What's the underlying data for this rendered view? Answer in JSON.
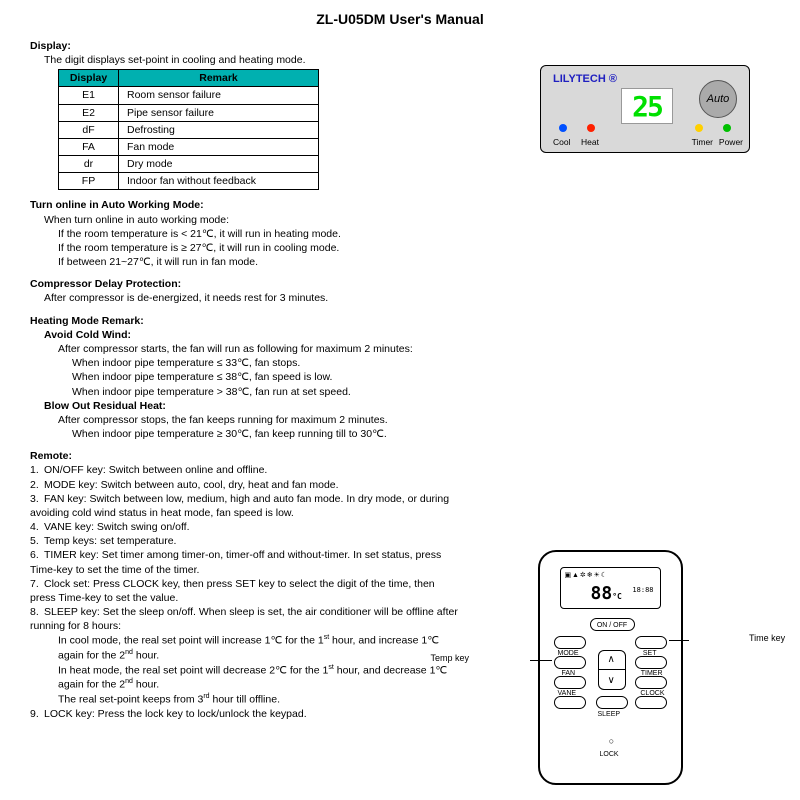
{
  "title": "ZL-U05DM User's Manual",
  "display": {
    "heading": "Display:",
    "intro": "The digit displays set-point in cooling and heating mode.",
    "headers": {
      "c1": "Display",
      "c2": "Remark"
    },
    "rows": [
      {
        "code": "E1",
        "remark": "Room sensor failure"
      },
      {
        "code": "E2",
        "remark": "Pipe sensor failure"
      },
      {
        "code": "dF",
        "remark": "Defrosting"
      },
      {
        "code": "FA",
        "remark": "Fan mode"
      },
      {
        "code": "dr",
        "remark": "Dry mode"
      },
      {
        "code": "FP",
        "remark": "Indoor fan without feedback"
      }
    ]
  },
  "panel": {
    "brand": "LILYTECH ®",
    "auto": "Auto",
    "digits": "25",
    "labels": {
      "cool": "Cool",
      "heat": "Heat",
      "timer": "Timer",
      "power": "Power"
    }
  },
  "auto_mode": {
    "heading": "Turn online in Auto Working Mode:",
    "l1": "When turn online in auto working mode:",
    "l2": "If the room temperature is < 21℃, it will run in heating mode.",
    "l3": "If the room temperature is ≥ 27℃, it will run in cooling mode.",
    "l4": "If between 21~27℃, it will run in fan mode."
  },
  "compressor": {
    "heading": "Compressor Delay Protection:",
    "l1": "After compressor is de-energized, it needs rest for 3 minutes."
  },
  "heating": {
    "heading": "Heating Mode Remark:",
    "avoid_h": "Avoid Cold Wind:",
    "a1": "After compressor starts, the fan will run as following for maximum 2 minutes:",
    "a2": "When indoor pipe temperature ≤ 33℃, fan stops.",
    "a3": "When indoor pipe temperature ≤ 38℃, fan speed is low.",
    "a4": "When indoor pipe temperature > 38℃, fan run at set speed.",
    "blow_h": "Blow Out Residual Heat:",
    "b1": "After compressor stops, the fan keeps running for maximum 2 minutes.",
    "b2": "When indoor pipe temperature ≥ 30℃, fan keep running till to 30℃."
  },
  "remote": {
    "heading": "Remote:",
    "callout_temp": "Temp key",
    "callout_time": "Time key",
    "onoff": "ON / OFF",
    "mode": "MODE",
    "set": "SET",
    "fan": "FAN",
    "timer": "TIMER",
    "vane": "VANE",
    "sleep": "SLEEP",
    "clock": "CLOCK",
    "lock": "LOCK",
    "lcd_temp": "88",
    "lcd_unit": "°C",
    "lcd_time": "18:88",
    "items": [
      "ON/OFF key: Switch between online and offline.",
      "MODE key: Switch between auto, cool, dry, heat and fan mode.",
      "FAN key: Switch between low, medium, high and auto fan mode. In dry mode, or during avoiding cold wind status in heat mode, fan speed is low.",
      "VANE key: Switch swing on/off.",
      "Temp keys: set temperature.",
      "TIMER key: Set timer among timer-on, timer-off and without-timer. In set status, press Time-key to set the time of the timer.",
      "Clock set: Press CLOCK key, then press SET key to select the digit of the time, then press Time-key to set the value.",
      "SLEEP key: Set the sleep on/off. When sleep is set, the air conditioner will be offline after running for 8 hours:",
      "LOCK key: Press the lock key to lock/unlock the keypad."
    ],
    "sleep_sub": [
      "In cool mode, the real set point will increase 1℃ for the 1st hour, and increase 1℃ again for the 2nd hour.",
      "In heat mode, the real set point will decrease 2℃ for the 1st hour, and decrease 1℃ again for the 2nd hour.",
      "The real set-point keeps from 3rd hour till offline."
    ]
  }
}
